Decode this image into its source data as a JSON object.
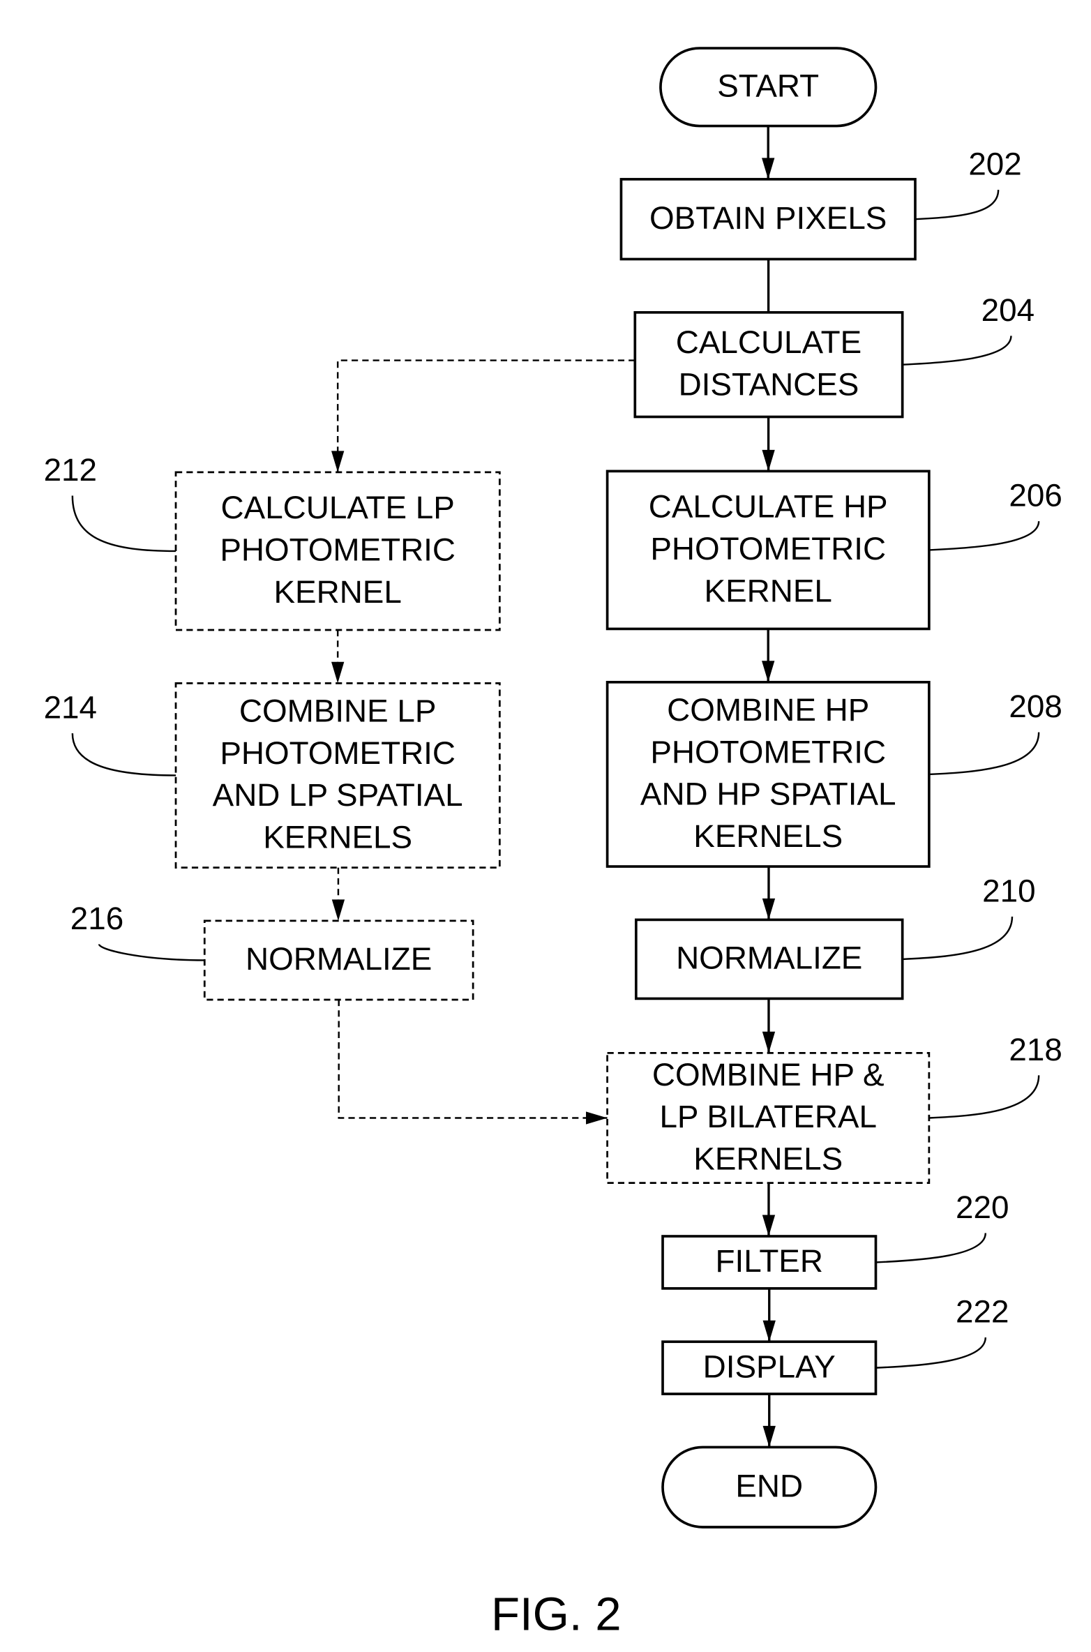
{
  "figure": {
    "caption": "FIG. 2",
    "nodes": [
      {
        "id": "start",
        "ref": "",
        "lines": [
          "START"
        ],
        "style": "terminal"
      },
      {
        "id": "obtain-pixels",
        "ref": "202",
        "lines": [
          "OBTAIN PIXELS"
        ],
        "style": "solid"
      },
      {
        "id": "calculate-distances",
        "ref": "204",
        "lines": [
          "CALCULATE",
          "DISTANCES"
        ],
        "style": "solid"
      },
      {
        "id": "calculate-hp-kernel",
        "ref": "206",
        "lines": [
          "CALCULATE HP",
          "PHOTOMETRIC",
          "KERNEL"
        ],
        "style": "solid"
      },
      {
        "id": "combine-hp-kernels",
        "ref": "208",
        "lines": [
          "COMBINE HP",
          "PHOTOMETRIC",
          "AND HP SPATIAL",
          "KERNELS"
        ],
        "style": "solid"
      },
      {
        "id": "normalize-hp",
        "ref": "210",
        "lines": [
          "NORMALIZE"
        ],
        "style": "solid"
      },
      {
        "id": "calculate-lp-kernel",
        "ref": "212",
        "lines": [
          "CALCULATE LP",
          "PHOTOMETRIC",
          "KERNEL"
        ],
        "style": "dashed"
      },
      {
        "id": "combine-lp-kernels",
        "ref": "214",
        "lines": [
          "COMBINE LP",
          "PHOTOMETRIC",
          "AND LP SPATIAL",
          "KERNELS"
        ],
        "style": "dashed"
      },
      {
        "id": "normalize-lp",
        "ref": "216",
        "lines": [
          "NORMALIZE"
        ],
        "style": "dashed"
      },
      {
        "id": "combine-bilateral",
        "ref": "218",
        "lines": [
          "COMBINE HP &",
          "LP BILATERAL",
          "KERNELS"
        ],
        "style": "dashed"
      },
      {
        "id": "filter",
        "ref": "220",
        "lines": [
          "FILTER"
        ],
        "style": "solid"
      },
      {
        "id": "display",
        "ref": "222",
        "lines": [
          "DISPLAY"
        ],
        "style": "solid"
      },
      {
        "id": "end",
        "ref": "",
        "lines": [
          "END"
        ],
        "style": "terminal"
      }
    ],
    "edges": [
      {
        "from": "start",
        "to": "obtain-pixels",
        "style": "solid"
      },
      {
        "from": "obtain-pixels",
        "to": "calculate-distances",
        "style": "solid"
      },
      {
        "from": "calculate-distances",
        "to": "calculate-hp-kernel",
        "style": "solid"
      },
      {
        "from": "calculate-hp-kernel",
        "to": "combine-hp-kernels",
        "style": "solid"
      },
      {
        "from": "combine-hp-kernels",
        "to": "normalize-hp",
        "style": "solid"
      },
      {
        "from": "normalize-hp",
        "to": "combine-bilateral",
        "style": "solid"
      },
      {
        "from": "calculate-distances",
        "to": "calculate-lp-kernel",
        "style": "dashed"
      },
      {
        "from": "calculate-lp-kernel",
        "to": "combine-lp-kernels",
        "style": "dashed"
      },
      {
        "from": "combine-lp-kernels",
        "to": "normalize-lp",
        "style": "dashed"
      },
      {
        "from": "normalize-lp",
        "to": "combine-bilateral",
        "style": "dashed"
      },
      {
        "from": "combine-bilateral",
        "to": "filter",
        "style": "solid"
      },
      {
        "from": "filter",
        "to": "display",
        "style": "solid"
      },
      {
        "from": "display",
        "to": "end",
        "style": "solid"
      }
    ]
  }
}
